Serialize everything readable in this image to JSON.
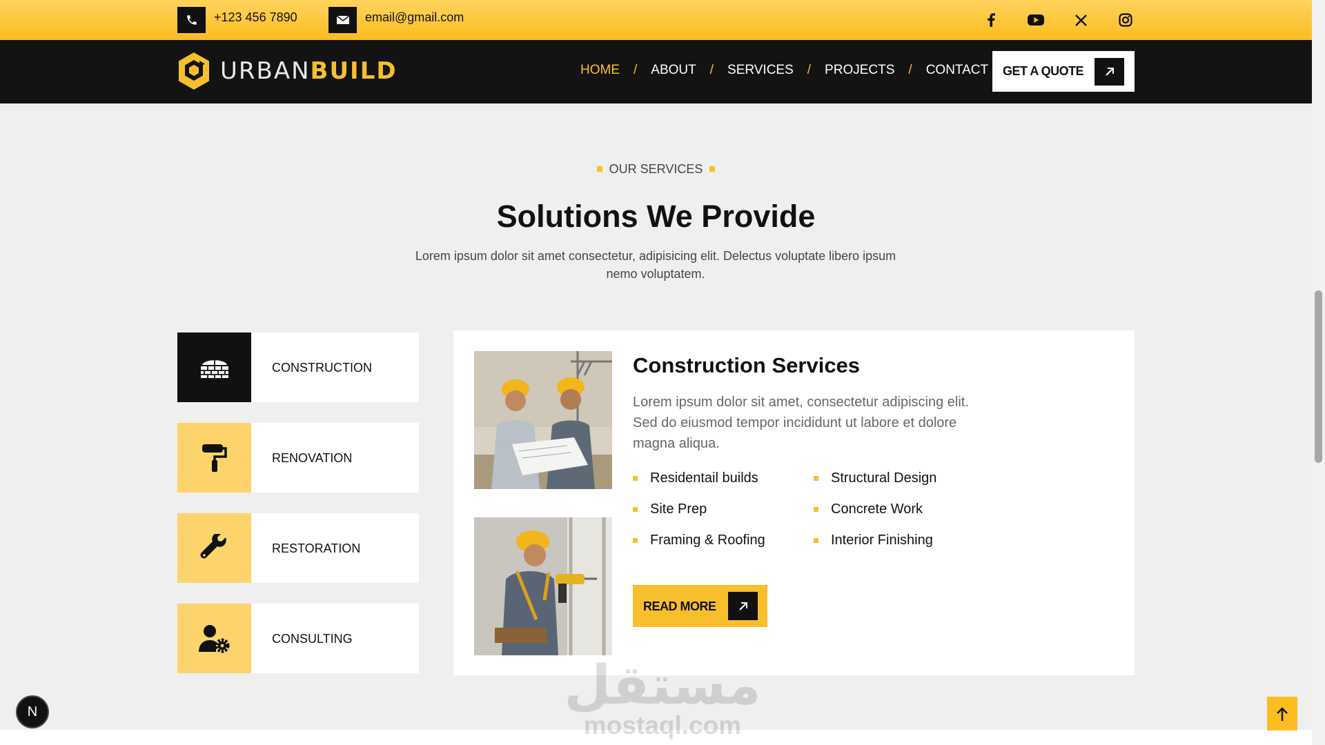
{
  "topbar": {
    "phone": "+123 456 7890",
    "email": "email@gmail.com",
    "phone_icon": "phone-icon",
    "email_icon": "envelope-icon",
    "social": [
      "facebook-icon",
      "youtube-icon",
      "x-icon",
      "instagram-icon"
    ]
  },
  "brand": {
    "light": "URBAN",
    "bold": "BUILD"
  },
  "nav": {
    "items": [
      {
        "label": "HOME",
        "active": true
      },
      {
        "label": "ABOUT"
      },
      {
        "label": "SERVICES"
      },
      {
        "label": "PROJECTS"
      },
      {
        "label": "CONTACT"
      }
    ],
    "separator": "/",
    "cta": "GET A QUOTE"
  },
  "section": {
    "eyebrow": "OUR SERVICES",
    "title": "Solutions We Provide",
    "subtitle": "Lorem ipsum dolor sit amet consectetur, adipisicing elit. Delectus voluptate libero ipsum nemo voluptatem."
  },
  "tabs": [
    {
      "label": "CONSTRUCTION",
      "icon": "brick-wall-icon",
      "active": true
    },
    {
      "label": "RENOVATION",
      "icon": "paint-roller-icon"
    },
    {
      "label": "RESTORATION",
      "icon": "wrench-icon"
    },
    {
      "label": "CONSULTING",
      "icon": "user-gear-icon"
    }
  ],
  "detail": {
    "title": "Construction Services",
    "description": "Lorem ipsum dolor sit amet, consectetur adipiscing elit. Sed do eiusmod tempor incididunt ut labore et dolore magna aliqua.",
    "features_left": [
      "Residentail builds",
      "Site Prep",
      "Framing & Roofing"
    ],
    "features_right": [
      "Structural Design",
      "Concrete Work",
      "Interior Finishing"
    ],
    "button": "READ MORE"
  },
  "watermark": {
    "arabic": "مستقل",
    "latin": "mostaql.com"
  },
  "badge": "N",
  "colors": {
    "accent": "#f8bf2c",
    "dark": "#131313",
    "background": "#efefef"
  }
}
